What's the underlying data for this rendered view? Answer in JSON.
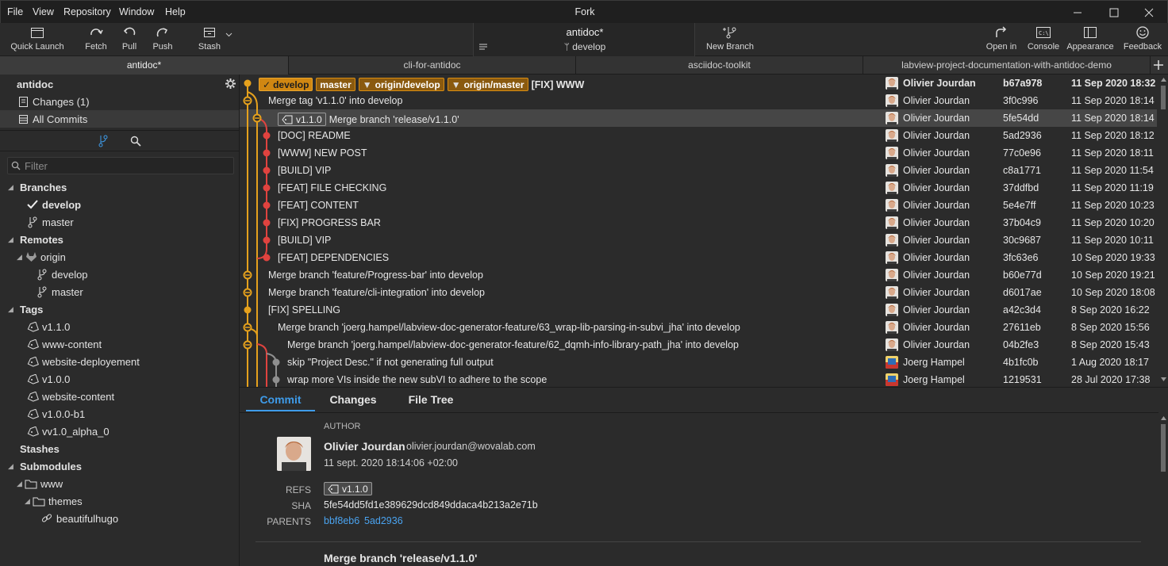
{
  "app": {
    "title": "Fork",
    "menu": [
      "File",
      "View",
      "Repository",
      "Window",
      "Help"
    ]
  },
  "toolbar": {
    "quick_launch": "Quick Launch",
    "fetch": "Fetch",
    "pull": "Pull",
    "push": "Push",
    "stash": "Stash",
    "repo_name": "antidoc*",
    "repo_branch": "develop",
    "new_branch": "New Branch",
    "open_in": "Open in",
    "console": "Console",
    "appearance": "Appearance",
    "feedback": "Feedback"
  },
  "tabs": [
    "antidoc*",
    "cli-for-antidoc",
    "asciidoc-toolkit",
    "labview-project-documentation-with-antidoc-demo"
  ],
  "sidebar": {
    "repo": "antidoc",
    "changes": "Changes (1)",
    "all_commits": "All Commits",
    "filter_placeholder": "Filter",
    "branches_header": "Branches",
    "branches": [
      "develop",
      "master"
    ],
    "remotes_header": "Remotes",
    "remote_name": "origin",
    "remote_branches": [
      "develop",
      "master"
    ],
    "tags_header": "Tags",
    "tags": [
      "v1.1.0",
      "www-content",
      "website-deployement",
      "v1.0.0",
      "website-content",
      "v1.0.0-b1",
      "vv1.0_alpha_0"
    ],
    "stashes_header": "Stashes",
    "submodules_header": "Submodules",
    "submodule": "www",
    "submodule_child": "themes",
    "submodule_leaf": "beautifulhugo"
  },
  "refs_row0": {
    "local": "develop",
    "master": "master",
    "origin_develop": "origin/develop",
    "origin_master": "origin/master"
  },
  "commits": [
    {
      "message": "[FIX] WWW",
      "author": "Olivier Jourdan",
      "sha": "b67a978",
      "date": "11 Sep 2020 18:32"
    },
    {
      "message": "Merge tag 'v1.1.0' into develop",
      "author": "Olivier Jourdan",
      "sha": "3f0c996",
      "date": "11 Sep 2020 18:14"
    },
    {
      "message": "Merge branch 'release/v1.1.0'",
      "tag": "v1.1.0",
      "author": "Olivier Jourdan",
      "sha": "5fe54dd",
      "date": "11 Sep 2020 18:14"
    },
    {
      "message": "[DOC] README",
      "author": "Olivier Jourdan",
      "sha": "5ad2936",
      "date": "11 Sep 2020 18:12"
    },
    {
      "message": "[WWW] NEW POST",
      "author": "Olivier Jourdan",
      "sha": "77c0e96",
      "date": "11 Sep 2020 18:11"
    },
    {
      "message": "[BUILD] VIP",
      "author": "Olivier Jourdan",
      "sha": "c8a1771",
      "date": "11 Sep 2020 11:54"
    },
    {
      "message": "[FEAT] FILE CHECKING",
      "author": "Olivier Jourdan",
      "sha": "37ddfbd",
      "date": "11 Sep 2020 11:19"
    },
    {
      "message": "[FEAT] CONTENT",
      "author": "Olivier Jourdan",
      "sha": "5e4e7ff",
      "date": "11 Sep 2020 10:23"
    },
    {
      "message": "[FIX] PROGRESS BAR",
      "author": "Olivier Jourdan",
      "sha": "37b04c9",
      "date": "11 Sep 2020 10:20"
    },
    {
      "message": "[BUILD] VIP",
      "author": "Olivier Jourdan",
      "sha": "30c9687",
      "date": "11 Sep 2020 10:11"
    },
    {
      "message": "[FEAT] DEPENDENCIES",
      "author": "Olivier Jourdan",
      "sha": "3fc63e6",
      "date": "10 Sep 2020 19:33"
    },
    {
      "message": "Merge branch 'feature/Progress-bar' into develop",
      "author": "Olivier Jourdan",
      "sha": "b60e77d",
      "date": "10 Sep 2020 19:21"
    },
    {
      "message": "Merge branch 'feature/cli-integration' into develop",
      "author": "Olivier Jourdan",
      "sha": "d6017ae",
      "date": "10 Sep 2020 18:08"
    },
    {
      "message": "[FIX] SPELLING",
      "author": "Olivier Jourdan",
      "sha": "a42c3d4",
      "date": "8 Sep 2020 16:22"
    },
    {
      "message": "Merge branch 'joerg.hampel/labview-doc-generator-feature/63_wrap-lib-parsing-in-subvi_jha' into develop",
      "author": "Olivier Jourdan",
      "sha": "27611eb",
      "date": "8 Sep 2020 15:56"
    },
    {
      "message": "Merge branch 'joerg.hampel/labview-doc-generator-feature/62_dqmh-info-library-path_jha' into develop",
      "author": "Olivier Jourdan",
      "sha": "04b2fe3",
      "date": "8 Sep 2020 15:43"
    },
    {
      "message": "skip \"Project Desc.\" if not generating full output",
      "author": "Joerg Hampel",
      "sha": "4b1fc0b",
      "date": "1 Aug 2020 18:17"
    },
    {
      "message": "wrap more VIs inside the new subVI to adhere to the scope",
      "author": "Joerg Hampel",
      "sha": "1219531",
      "date": "28 Jul 2020 17:38"
    }
  ],
  "details": {
    "tabs": [
      "Commit",
      "Changes",
      "File Tree"
    ],
    "author_header": "AUTHOR",
    "author_name": "Olivier Jourdan",
    "author_email": "olivier.jourdan@wovalab.com",
    "author_date": "11 sept. 2020 18:14:06 +02:00",
    "refs_label": "REFS",
    "refs_tag": "v1.1.0",
    "sha_label": "SHA",
    "sha": "5fe54dd5fd1e389629dcd849ddaca4b213a2e71b",
    "parents_label": "PARENTS",
    "parent1": "bbf8eb6",
    "parent2": "5ad2936",
    "message": "Merge branch 'release/v1.1.0'"
  },
  "colors": {
    "accent": "#3e9be9",
    "branch_orange": "#e5a11d",
    "branch_red": "#e0433f",
    "selection": "#464646"
  }
}
